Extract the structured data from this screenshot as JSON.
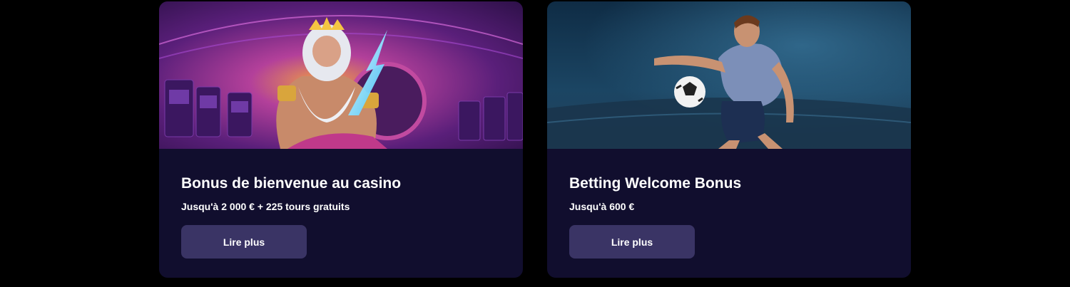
{
  "cards": [
    {
      "title": "Bonus de bienvenue au casino",
      "subtitle": "Jusqu'à 2 000 € + 225 tours gratuits",
      "button_label": "Lire plus",
      "image": "casino-zeus-illustration",
      "accent": "#8a2fb3"
    },
    {
      "title": "Betting Welcome Bonus",
      "subtitle": "Jusqu'à 600 €",
      "button_label": "Lire plus",
      "image": "football-player-illustration",
      "accent": "#1f4a6e"
    }
  ],
  "colors": {
    "page_background": "#000000",
    "card_background": "#110e2e",
    "button_background": "#3a3465",
    "text": "#ffffff"
  }
}
